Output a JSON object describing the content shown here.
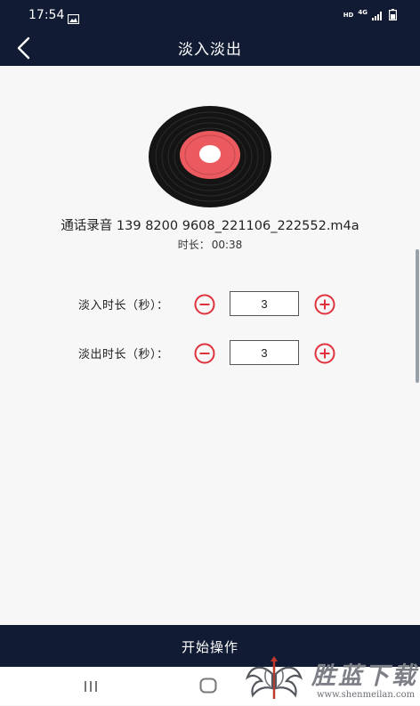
{
  "status_bar": {
    "time": "17:54",
    "gallery_icon": "image-icon",
    "hd_label": "HD",
    "network_label": "4G",
    "signal_icon": "signal-icon",
    "battery_icon": "battery-icon"
  },
  "header": {
    "title": "淡入淡出",
    "back_icon": "chevron-left-icon"
  },
  "audio": {
    "cover_icon": "vinyl-record-icon",
    "file_name": "通话录音 139 8200 9608_221106_222552.m4a",
    "duration_label": "时长：",
    "duration_value": "00:38"
  },
  "settings": {
    "fade_in": {
      "label": "淡入时长（秒）：",
      "value": "3",
      "decrement_icon": "minus-circle-icon",
      "increment_icon": "plus-circle-icon"
    },
    "fade_out": {
      "label": "淡出时长（秒）：",
      "value": "3",
      "decrement_icon": "minus-circle-icon",
      "increment_icon": "plus-circle-icon"
    }
  },
  "action": {
    "start_label": "开始操作"
  },
  "nav_bar": {
    "recents_icon": "recents-icon",
    "home_icon": "home-icon"
  },
  "watermark": {
    "title": "胜蓝下载",
    "url": "www.shenmeilan.com",
    "emblem_icon": "dragon-emblem-icon"
  },
  "colors": {
    "header_bg": "#111b33",
    "accent_red": "#e0323c",
    "vinyl_label": "#ea5a5f",
    "content_bg": "#f7f7f7"
  }
}
